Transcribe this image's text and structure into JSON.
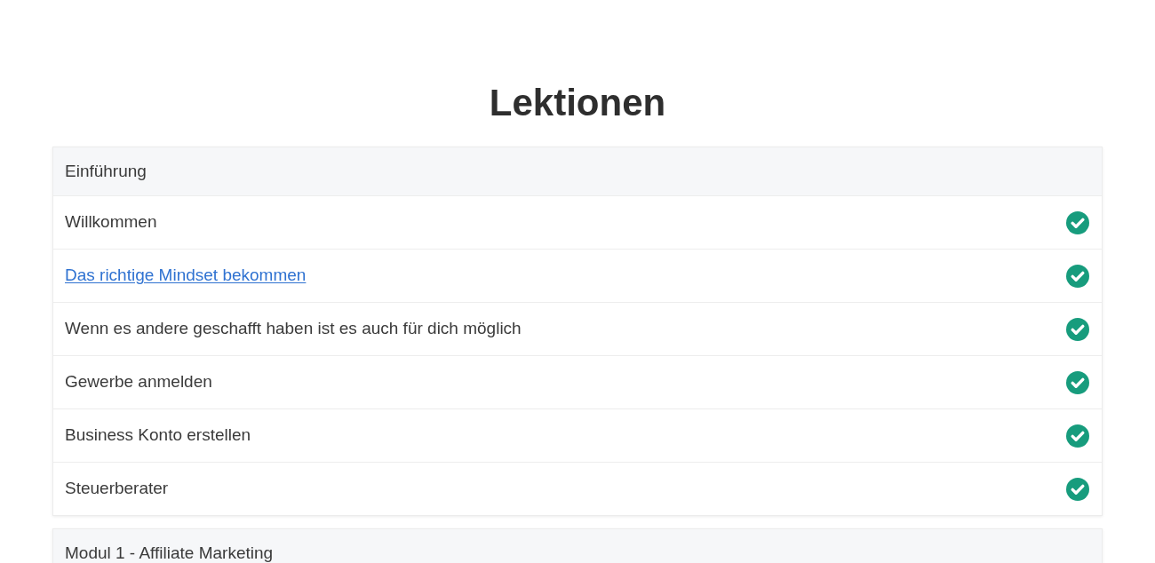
{
  "page": {
    "title": "Lektionen"
  },
  "modules": [
    {
      "title": "Einführung",
      "lessons": [
        {
          "title": "Willkommen",
          "kind": "text",
          "completed": true
        },
        {
          "title": "Das richtige Mindset bekommen",
          "kind": "link",
          "completed": true
        },
        {
          "title": "Wenn es andere geschafft haben ist es auch für dich möglich",
          "kind": "text",
          "completed": true
        },
        {
          "title": "Gewerbe anmelden",
          "kind": "text",
          "completed": true
        },
        {
          "title": "Business Konto erstellen",
          "kind": "text",
          "completed": true
        },
        {
          "title": "Steuerberater",
          "kind": "text",
          "completed": true
        }
      ]
    },
    {
      "title": "Modul 1 - Affiliate Marketing"
    }
  ]
}
